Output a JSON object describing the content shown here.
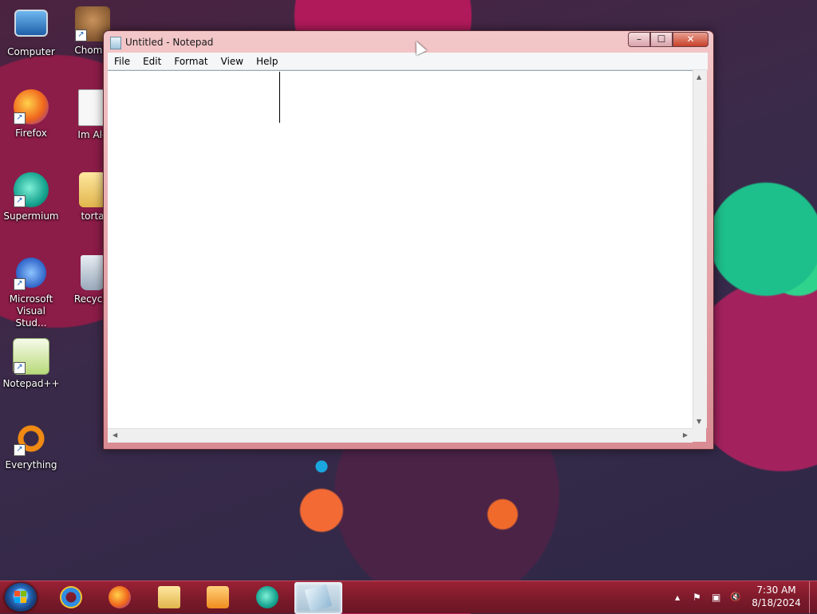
{
  "desktop": {
    "icons": [
      {
        "label": "Computer"
      },
      {
        "label": "Chomik"
      },
      {
        "label": "Firefox"
      },
      {
        "label": "Im Alc"
      },
      {
        "label": "Supermium"
      },
      {
        "label": "torta"
      },
      {
        "label": "Microsoft Visual Stud..."
      },
      {
        "label": "Recycle"
      },
      {
        "label": "Notepad++"
      },
      {
        "label": "Everything"
      }
    ]
  },
  "window": {
    "title": "Untitled - Notepad",
    "controls": {
      "minimize": "–",
      "maximize": "☐",
      "close": "✕"
    },
    "menu": [
      "File",
      "Edit",
      "Format",
      "View",
      "Help"
    ],
    "content": ""
  },
  "taskbar": {
    "apps": [
      {
        "name": "internet-explorer"
      },
      {
        "name": "firefox"
      },
      {
        "name": "file-explorer"
      },
      {
        "name": "media-player"
      },
      {
        "name": "supermium"
      },
      {
        "name": "notepad",
        "active": true
      }
    ],
    "tray": {
      "arrow": "▲",
      "flag": "⚑",
      "network": "▣",
      "volume": "🔇"
    },
    "time": "7:30 AM",
    "date": "8/18/2024"
  },
  "colors": {
    "taskbar": "#7c1a2b",
    "window_frame": "#e0a4ab",
    "close_button": "#c8402a"
  }
}
